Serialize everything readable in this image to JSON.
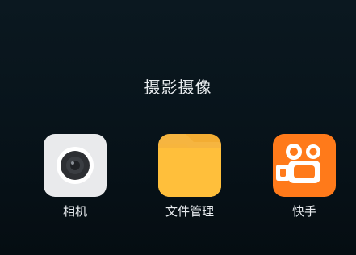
{
  "folder": {
    "title": "摄影摄像"
  },
  "apps": [
    {
      "label": "相机",
      "icon": "camera-icon"
    },
    {
      "label": "文件管理",
      "icon": "folder-icon"
    },
    {
      "label": "快手",
      "icon": "kuaishou-icon"
    }
  ],
  "colors": {
    "background": "#08141b",
    "text": "#e8ecef",
    "files_accent": "#f3ad33",
    "kuaishou_accent": "#ff7a1a"
  }
}
